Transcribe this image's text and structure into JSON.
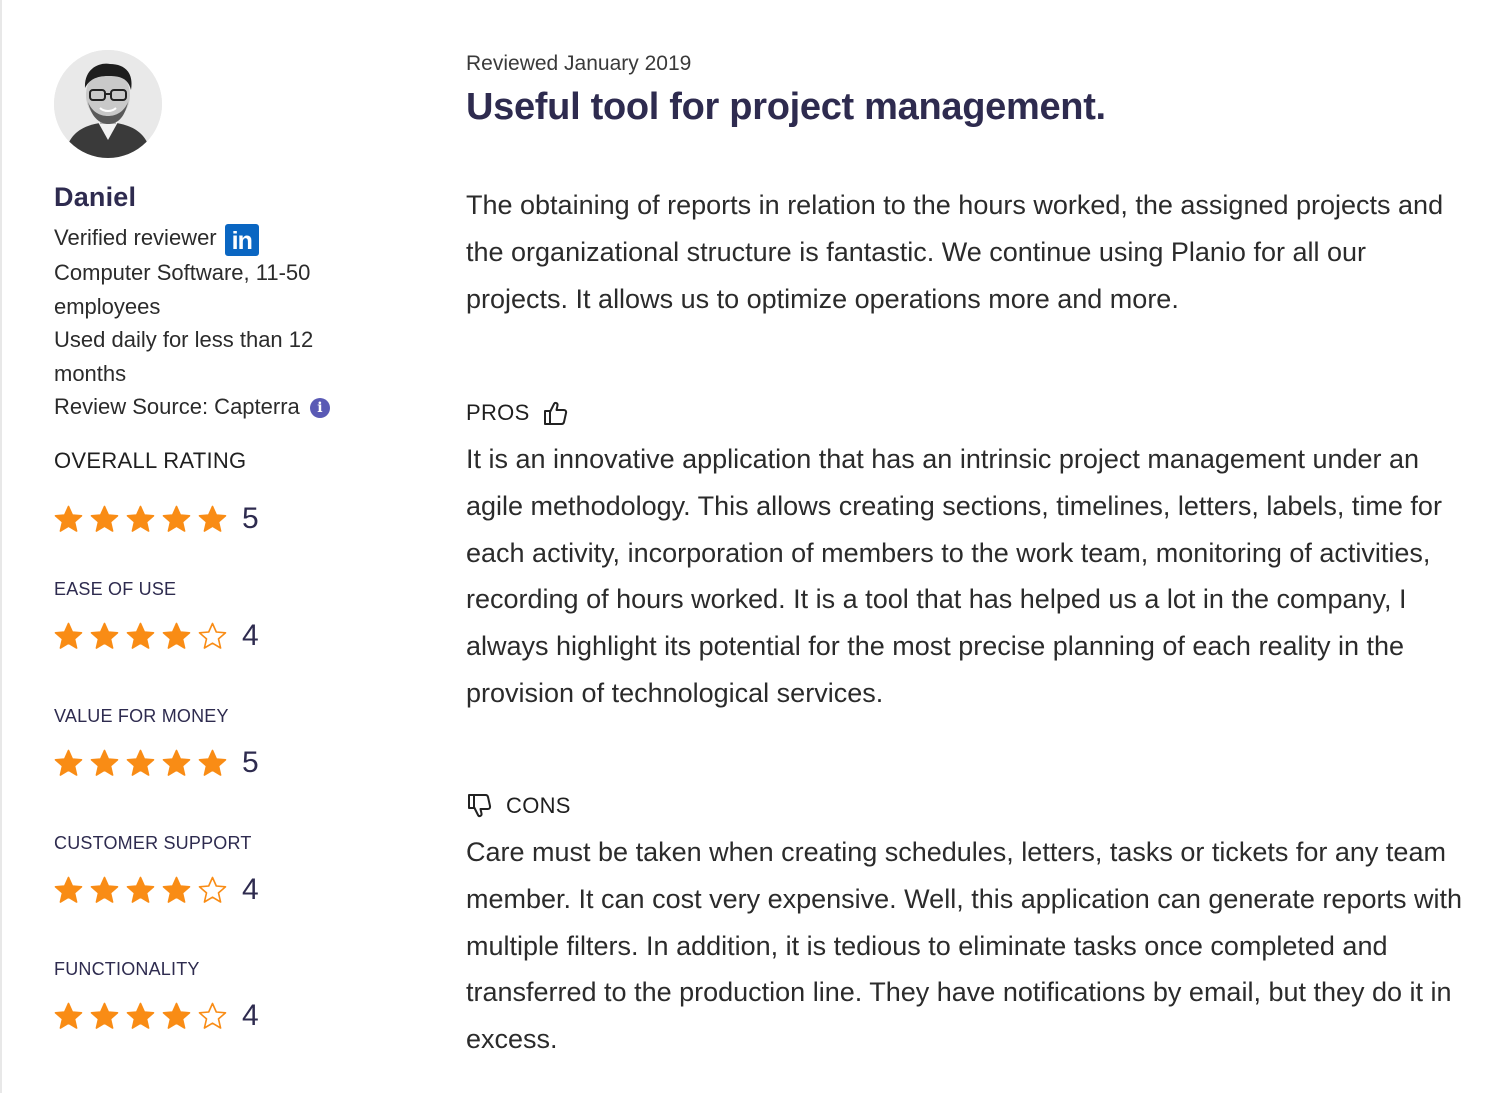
{
  "reviewer": {
    "name": "Daniel",
    "verified_label": "Verified reviewer",
    "linkedin_icon": "linkedin-icon",
    "industry_line1": "Computer Software, 11-50",
    "industry_line2": "employees",
    "usage_line1": "Used daily for less than 12",
    "usage_line2": "months",
    "source": "Review Source: Capterra",
    "info_icon": "info-icon"
  },
  "ratings": {
    "overall": {
      "label": "OVERALL RATING",
      "score": "5",
      "stars": 5
    },
    "ease_of_use": {
      "label": "EASE OF USE",
      "score": "4",
      "stars": 4
    },
    "value_for_money": {
      "label": "VALUE FOR MONEY",
      "score": "5",
      "stars": 5
    },
    "customer_support": {
      "label": "CUSTOMER SUPPORT",
      "score": "4",
      "stars": 4
    },
    "functionality": {
      "label": "FUNCTIONALITY",
      "score": "4",
      "stars": 4
    }
  },
  "review": {
    "date": "Reviewed January 2019",
    "title": "Useful tool for project management.",
    "summary": "The obtaining of reports in relation to the hours worked, the assigned projects and the organizational structure is fantastic. We continue using Planio for all our projects. It allows us to optimize operations more and more.",
    "pros_label": "PROS",
    "pros": "It is an innovative application that has an intrinsic project management under an agile methodology. This allows creating sections, timelines, letters, labels, time for each activity, incorporation of members to the work team, monitoring of activities, recording of hours worked. It is a tool that has helped us a lot in the company, I always highlight its potential for the most precise planning of each reality in the provision of technological services.",
    "cons_label": "CONS",
    "cons": "Care must be taken when creating schedules, letters, tasks or tickets for any team member. It can cost very expensive. Well, this application can generate reports with multiple filters. In addition, it is tedious to eliminate tasks once completed and transferred to the production line. They have notifications by email, but they do it in excess."
  },
  "colors": {
    "star_filled": "#f98c15",
    "title": "#2e2b4f",
    "linkedin": "#0a66c2"
  }
}
